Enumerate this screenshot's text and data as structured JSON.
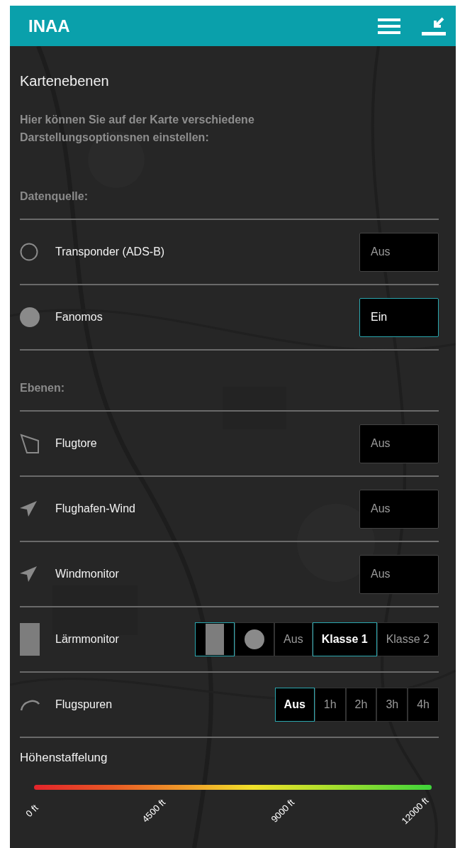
{
  "header": {
    "title": "INAA"
  },
  "panel": {
    "title": "Kartenebenen",
    "description": "Hier können Sie auf der Karte verschiedene Darstellungsoptionsnen einstellen:",
    "sections": [
      {
        "label": "Datenquelle:",
        "rows": [
          {
            "kind": "ring",
            "label": "Transponder (ADS-B)",
            "options": [
              {
                "kind": "text",
                "label": "Aus",
                "selected": false
              }
            ]
          },
          {
            "kind": "dot",
            "label": "Fanomos",
            "options": [
              {
                "kind": "text",
                "label": "Ein",
                "selected": true
              }
            ]
          }
        ]
      },
      {
        "label": "Ebenen:",
        "rows": [
          {
            "kind": "gate",
            "label": "Flugtore",
            "options": [
              {
                "kind": "text",
                "label": "Aus",
                "selected": false
              }
            ]
          },
          {
            "kind": "arrow",
            "label": "Flughafen-Wind",
            "options": [
              {
                "kind": "text",
                "label": "Aus",
                "selected": false
              }
            ]
          },
          {
            "kind": "arrow",
            "label": "Windmonitor",
            "options": [
              {
                "kind": "text",
                "label": "Aus",
                "selected": false
              }
            ]
          },
          {
            "kind": "bar",
            "label": "Lärmmonitor",
            "options": [
              {
                "kind": "bar",
                "selected": true
              },
              {
                "kind": "dot",
                "selected": false
              },
              {
                "kind": "text",
                "label": "Aus",
                "selected": false
              },
              {
                "kind": "text",
                "label": "Klasse 1",
                "selected": true
              },
              {
                "kind": "text",
                "label": "Klasse 2",
                "selected": false
              }
            ]
          },
          {
            "kind": "arc",
            "label": "Flugspuren",
            "options": [
              {
                "kind": "text",
                "label": "Aus",
                "selected": true
              },
              {
                "kind": "text",
                "label": "1h",
                "selected": false
              },
              {
                "kind": "text",
                "label": "2h",
                "selected": false
              },
              {
                "kind": "text",
                "label": "3h",
                "selected": false
              },
              {
                "kind": "text",
                "label": "4h",
                "selected": false
              }
            ]
          }
        ]
      }
    ],
    "altitude": {
      "title": "Höhenstaffelung",
      "ticks": [
        "0 ft",
        "4500 ft",
        "9000 ft",
        "12000 ft"
      ]
    }
  }
}
